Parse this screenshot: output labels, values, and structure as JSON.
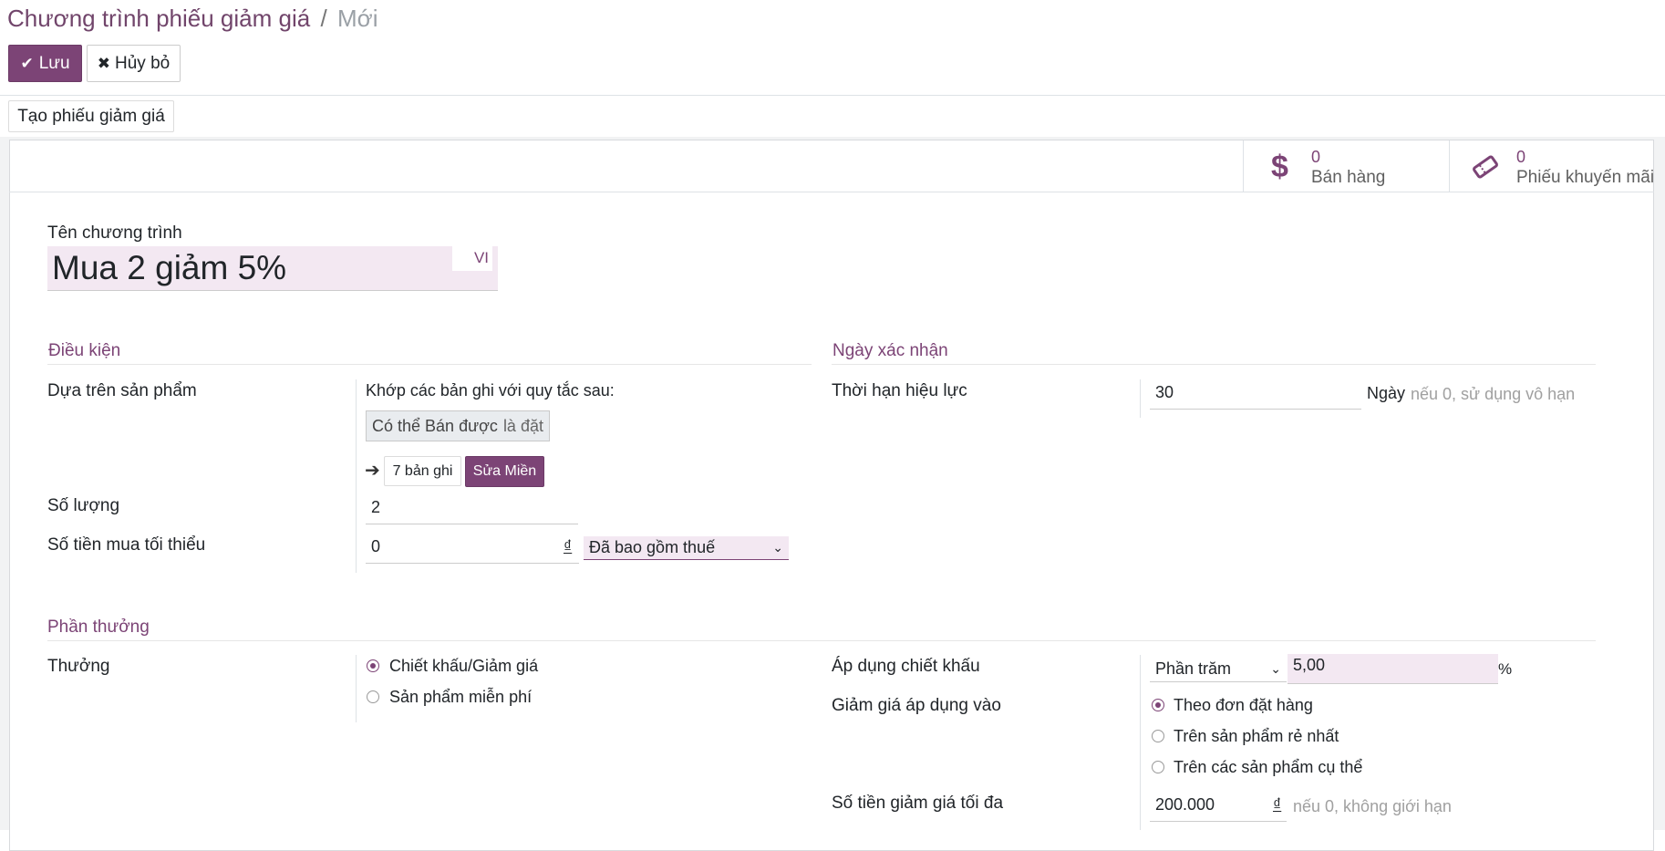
{
  "breadcrumb": {
    "parent": "Chương trình phiếu giảm giá",
    "separator": "/",
    "current": "Mới"
  },
  "toolbar": {
    "save_label": "Lưu",
    "discard_label": "Hủy bỏ"
  },
  "header_button": "Tạo phiếu giảm giá",
  "stats": {
    "sales": {
      "count": "0",
      "label": "Bán hàng"
    },
    "coupons": {
      "count": "0",
      "label": "Phiếu khuyến mãi"
    }
  },
  "program": {
    "name_label": "Tên chương trình",
    "name_value": "Mua 2 giảm 5%",
    "lang": "VI"
  },
  "conditions": {
    "title": "Điều kiện",
    "based_on_label": "Dựa trên sản phẩm",
    "match_text": "Khớp các bản ghi với quy tắc sau:",
    "rule_field": "Có thể Bán được",
    "rule_op": "là đặt",
    "records_label": "7 bản ghi",
    "edit_domain_label": "Sửa Miền",
    "qty_label": "Số lượng",
    "qty_value": "2",
    "min_amount_label": "Số tiền mua tối thiểu",
    "min_amount_value": "0",
    "currency": "₫",
    "tax_option": "Đã bao gồm thuế"
  },
  "validity": {
    "title": "Ngày xác nhận",
    "duration_label": "Thời hạn hiệu lực",
    "duration_value": "30",
    "unit": "Ngày",
    "hint": "nếu 0, sử dụng vô hạn"
  },
  "reward": {
    "title": "Phần thưởng",
    "reward_label": "Thưởng",
    "options": [
      "Chiết khấu/Giảm giá",
      "Sản phẩm miễn phí"
    ],
    "selected": 0,
    "apply_discount_label": "Áp dụng chiết khấu",
    "discount_type": "Phần trăm",
    "discount_value": "5,00",
    "percent": "%",
    "apply_on_label": "Giảm giá áp dụng vào",
    "apply_on_options": [
      "Theo đơn đặt hàng",
      "Trên sản phẩm rẻ nhất",
      "Trên các sản phẩm cụ thể"
    ],
    "apply_on_selected": 0,
    "max_amount_label": "Số tiền giảm giá tối đa",
    "max_amount_value": "200.000",
    "currency": "₫",
    "max_hint": "nếu 0, không giới hạn"
  },
  "colors": {
    "brand": "#7c4476",
    "required_bg": "#f3e8f2"
  }
}
